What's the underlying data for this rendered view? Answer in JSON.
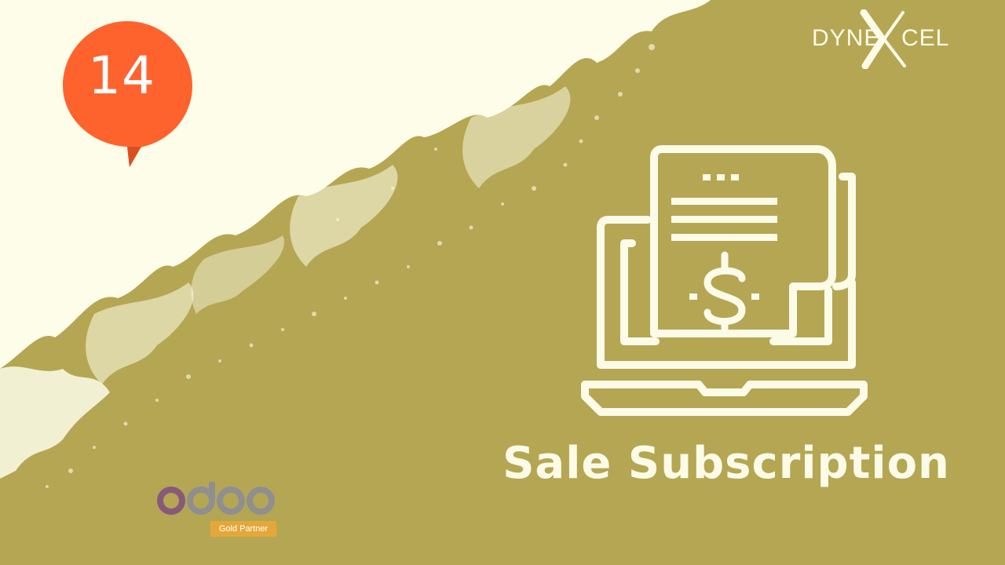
{
  "version_badge": {
    "number": "14",
    "color": "#ff632d"
  },
  "brand": {
    "left_text": "DYNE",
    "right_text": "CEL",
    "icon": "x-mark-icon"
  },
  "hero": {
    "icon": "invoice-laptop-dollar-icon",
    "title": "Sale Subscription"
  },
  "partner": {
    "logo": "odoo-logo",
    "tag": "Gold Partner",
    "tag_color": "#e4a83a"
  },
  "colors": {
    "background": "#b5a653",
    "cream": "#fdfde9",
    "foreground": "#fbfbe8"
  }
}
